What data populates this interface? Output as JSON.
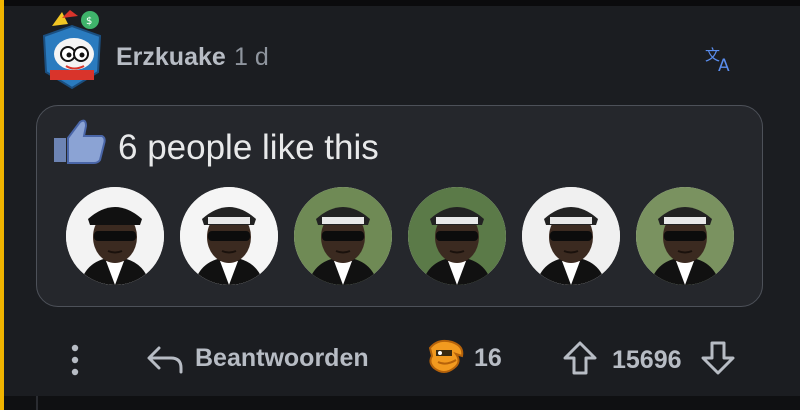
{
  "comment": {
    "author": "Erzkuake",
    "age": "1 d",
    "translate_icon": "translate-icon",
    "avatar_icon": "snoo-avatar-icon"
  },
  "like_card": {
    "text": "6 people like this",
    "icon": "thumbs-up-icon",
    "people_count": 6
  },
  "actions": {
    "menu_icon": "more-vertical-icon",
    "reply_label": "Beantwoorden",
    "reply_icon": "reply-arrow-icon",
    "award_icon": "award-icon",
    "award_count": "16",
    "score": "15696",
    "upvote_icon": "arrow-up-icon",
    "downvote_icon": "arrow-down-icon"
  },
  "colors": {
    "background": "#1b1d21",
    "thread_line": "#f0b400",
    "text_muted": "#b7bcc4",
    "accent_blue": "#5a8dee",
    "award_orange": "#f29a1f"
  }
}
